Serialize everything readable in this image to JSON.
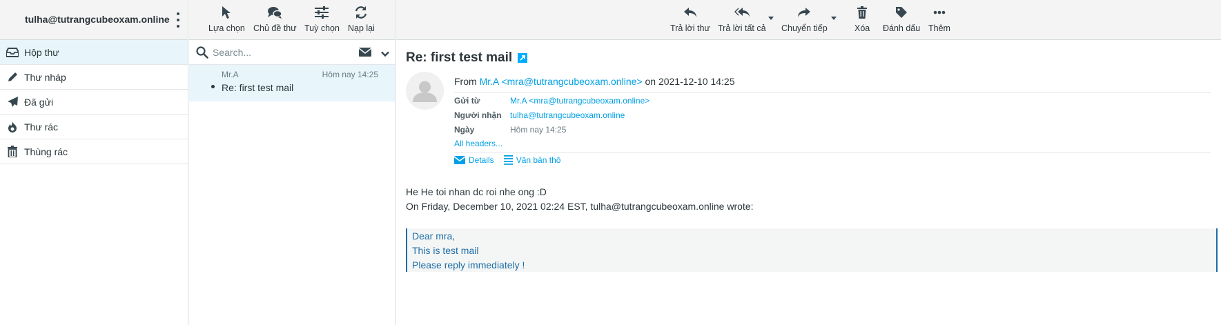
{
  "account": {
    "email": "tulha@tutrangcubeoxam.online"
  },
  "left_toolbar": [
    {
      "label": "Lựa chọn",
      "icon": "cursor-icon"
    },
    {
      "label": "Chủ đề thư",
      "icon": "threads-icon"
    },
    {
      "label": "Tuỳ chọn",
      "icon": "sliders-icon"
    },
    {
      "label": "Nạp lại",
      "icon": "refresh-icon"
    }
  ],
  "folders": [
    {
      "label": "Hộp thư",
      "icon": "inbox-icon",
      "active": true
    },
    {
      "label": "Thư nháp",
      "icon": "pencil-icon"
    },
    {
      "label": "Đã gửi",
      "icon": "paper-plane-icon"
    },
    {
      "label": "Thư rác",
      "icon": "fire-icon"
    },
    {
      "label": "Thùng rác",
      "icon": "trash-icon"
    }
  ],
  "search": {
    "placeholder": "Search..."
  },
  "message_list": [
    {
      "from": "Mr.A",
      "date": "Hôm nay 14:25",
      "subject": "Re: first test mail",
      "unread": true
    }
  ],
  "message_toolbar": [
    {
      "label": "Trả lời thư",
      "icon": "reply-icon"
    },
    {
      "label": "Trả lời tất cả",
      "icon": "reply-all-icon",
      "dropdown": true
    },
    {
      "label": "Chuyển tiếp",
      "icon": "forward-icon",
      "dropdown": true
    },
    {
      "label": "Xóa",
      "icon": "trash-icon"
    },
    {
      "label": "Đánh dấu",
      "icon": "tag-icon"
    },
    {
      "label": "Thêm",
      "icon": "more-icon"
    }
  ],
  "message": {
    "subject": "Re: first test mail",
    "from_prefix": "From",
    "from": "Mr.A <mra@tutrangcubeoxam.online>",
    "on": "on",
    "date_full": "2021-12-10 14:25",
    "headers": [
      {
        "name": "Gửi từ",
        "value": "Mr.A <mra@tutrangcubeoxam.online>",
        "link": true
      },
      {
        "name": "Người nhận",
        "value": "tulha@tutrangcubeoxam.online",
        "link": true
      },
      {
        "name": "Ngày",
        "value": "Hôm nay 14:25",
        "link": false
      }
    ],
    "all_headers": "All headers...",
    "view_details": "Details",
    "view_plain": "Văn bản thô",
    "body_lines": [
      "He He toi nhan dc roi nhe ong :D",
      "On Friday, December 10, 2021 02:24 EST, tulha@tutrangcubeoxam.online wrote:"
    ],
    "quote_lines": [
      "Dear mra,",
      "This is test mail",
      "Please reply immediately !"
    ]
  },
  "colors": {
    "accent": "#00a0e6",
    "selected_bg": "#e8f6fc",
    "quote_border": "#1e6da8"
  }
}
